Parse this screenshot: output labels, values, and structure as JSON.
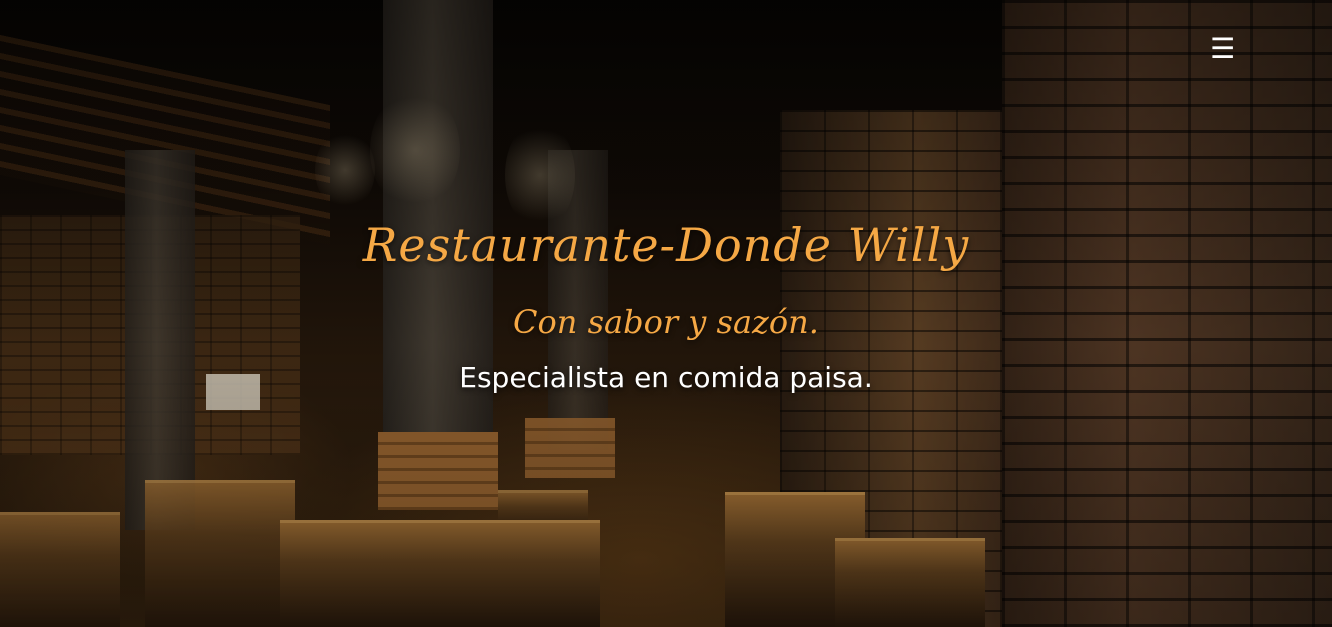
{
  "header": {
    "menu_icon": "hamburger-menu-icon",
    "menu_glyph": "☰"
  },
  "hero": {
    "title": "Restaurante-Donde Willy",
    "subtitle": "Con sabor y sazón.",
    "tagline": "Especialista en comida paisa."
  },
  "colors": {
    "accent": "#f5a845",
    "tagline_text": "#ffffff",
    "background": "#0d0906"
  }
}
